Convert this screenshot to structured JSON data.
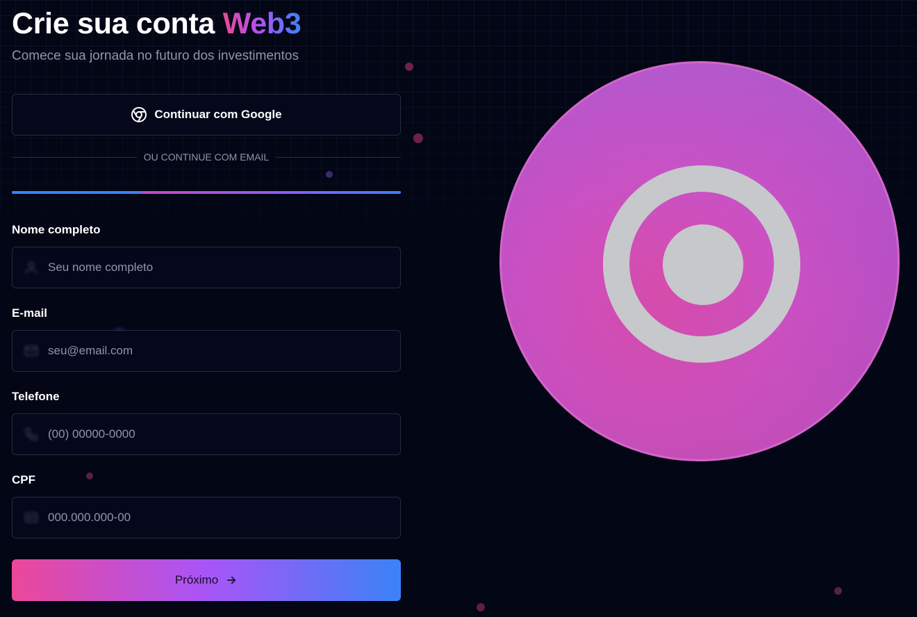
{
  "header": {
    "title_main": "Crie sua conta",
    "title_accent": "Web3",
    "subtitle": "Comece sua jornada no futuro dos investimentos"
  },
  "social": {
    "google_label": "Continuar com Google",
    "icon": "chrome-icon"
  },
  "divider_text": "OU CONTINUE COM EMAIL",
  "progress": {
    "step": 1,
    "total_steps": 3
  },
  "fields": [
    {
      "label": "Nome completo",
      "placeholder": "Seu nome completo",
      "value": "",
      "icon": "user-icon"
    },
    {
      "label": "E-mail",
      "placeholder": "seu@email.com",
      "value": "",
      "icon": "mail-icon"
    },
    {
      "label": "Telefone",
      "placeholder": "(00) 00000-0000",
      "value": "",
      "icon": "phone-icon"
    },
    {
      "label": "CPF",
      "placeholder": "000.000.000-00",
      "value": "",
      "icon": "id-card-icon"
    }
  ],
  "next_button": {
    "label": "Próximo",
    "icon": "arrow-right-icon"
  },
  "colors": {
    "background": "#030615",
    "accent_pink": "#ec4899",
    "accent_purple": "#a855f7",
    "accent_blue": "#3b82f6",
    "coin_pink": "#c94fc4",
    "coin_ring": "#c7c8cc"
  }
}
